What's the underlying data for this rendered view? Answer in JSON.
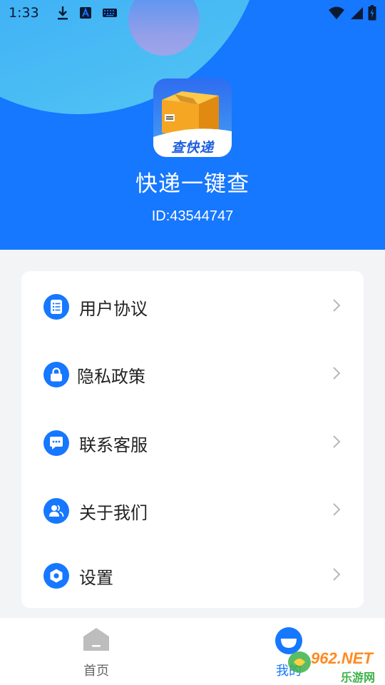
{
  "status_bar": {
    "time": "1:33",
    "left_icons": [
      "download-icon",
      "text-a-icon",
      "keyboard-icon"
    ],
    "right_icons": [
      "wifi-icon",
      "signal-icon",
      "battery-icon"
    ]
  },
  "profile": {
    "app_logo_text": "查快递",
    "app_name": "快递一键查",
    "user_id": "ID:43544747"
  },
  "menu": {
    "items": [
      {
        "label": "用户协议",
        "icon": "document-list-icon"
      },
      {
        "label": "隐私政策",
        "icon": "lock-icon"
      },
      {
        "label": "联系客服",
        "icon": "chat-bubble-icon"
      },
      {
        "label": "关于我们",
        "icon": "people-icon"
      },
      {
        "label": "设置",
        "icon": "gear-icon"
      }
    ]
  },
  "bottom_nav": {
    "tabs": [
      {
        "label": "首页",
        "icon": "home-icon",
        "active": false
      },
      {
        "label": "我的",
        "icon": "profile-icon",
        "active": true
      }
    ]
  },
  "watermark": {
    "text": "962.NET",
    "subtext": "乐游网"
  },
  "colors": {
    "primary": "#1677ff",
    "header_bg": "#1677ff",
    "page_bg": "#f3f4f6",
    "card_bg": "#ffffff",
    "text_primary": "#222222",
    "text_secondary": "#666666",
    "chevron": "#b8b8b8"
  }
}
